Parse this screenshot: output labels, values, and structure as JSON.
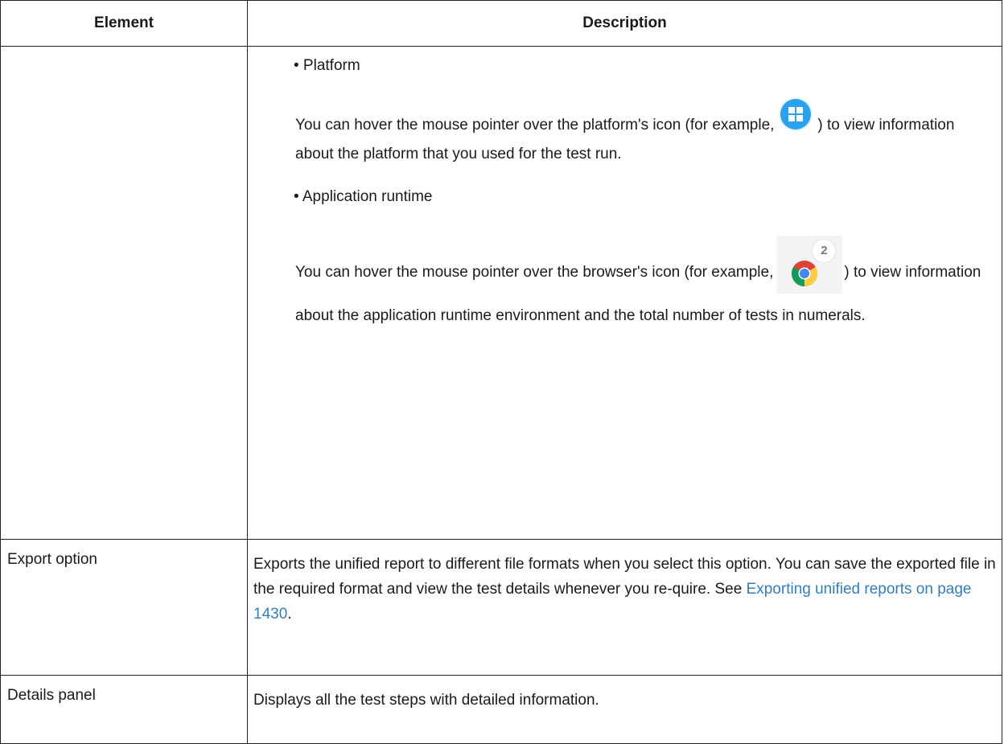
{
  "table": {
    "headers": {
      "element": "Element",
      "description": "Description"
    },
    "row1": {
      "element": "",
      "bullet1": "• Platform",
      "para1_before": "You can hover the mouse pointer over the platform's icon (for example,",
      "para1_after": ") to view information about the platform that you used for the test run.",
      "bullet2": "• Application runtime",
      "para2_before": "You can hover the mouse pointer over the browser's icon (for example,",
      "para2_after": ") to view information about the application runtime environment and the total number of tests in numerals.",
      "browser_count_badge": "2"
    },
    "row2": {
      "element": "Export option",
      "desc_before": "Exports the unified report to different file formats when you select this option. You can save the exported file in the required format and view the test details whenever you re-quire. See",
      "link": "Exporting unified reports on page 1430",
      "desc_after": "."
    },
    "row3": {
      "element": "Details panel",
      "desc": "Displays all the test steps with detailed information."
    }
  },
  "icons": {
    "platform_icon": "windows-icon",
    "browser_icon": "chrome-icon",
    "accent": "#29a3ef",
    "link_color": "#2f7ec2"
  }
}
